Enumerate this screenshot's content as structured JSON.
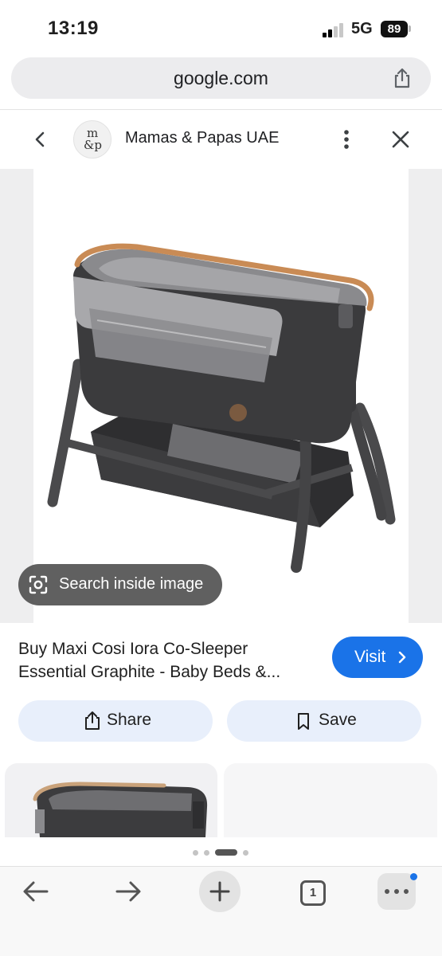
{
  "status_bar": {
    "time": "13:19",
    "network": "5G",
    "battery": "89"
  },
  "url_bar": {
    "url": "google.com",
    "share_icon": "share-icon"
  },
  "site_header": {
    "logo_line1": "m",
    "logo_line2": "&p",
    "site_name": "Mamas & Papas UAE"
  },
  "image_viewer": {
    "lens_label": "Search inside image"
  },
  "result": {
    "title_line1": "Buy Maxi Cosi Iora Co-Sleeper",
    "title_line2": "Essential Graphite - Baby Beds &...",
    "visit_label": "Visit"
  },
  "actions": {
    "share_label": "Share",
    "save_label": "Save"
  },
  "pagination": {
    "pages": 4,
    "active_index": 2
  },
  "toolbar": {
    "tab_count": "1"
  },
  "colors": {
    "accent": "#1a73e8",
    "chip_bg": "#e8effb",
    "graphite": "#3a3a3c"
  }
}
